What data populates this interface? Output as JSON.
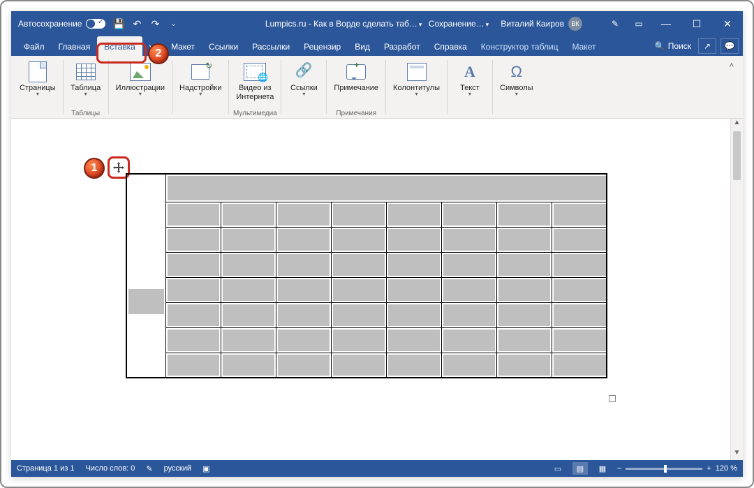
{
  "title": {
    "autosave": "Автосохранение",
    "doc": "Lumpics.ru - Как в Ворде сделать таб…",
    "saving": "Сохранение…",
    "user_name": "Виталий Каиров",
    "user_initials": "ВК"
  },
  "tabs": {
    "file": "Файл",
    "home": "Главная",
    "insert": "Вставка",
    "draw": "ук",
    "layout": "Макет",
    "refs": "Ссылки",
    "mail": "Рассылки",
    "review": "Рецензир",
    "view": "Вид",
    "dev": "Разработ",
    "help": "Справка",
    "ctx_design": "Конструктор таблиц",
    "ctx_layout": "Макет",
    "search": "Поиск"
  },
  "ribbon": {
    "pages": "Страницы",
    "table": "Таблица",
    "tables_grp": "Таблицы",
    "illus": "Иллюстрации",
    "addins": "Надстройки",
    "video_l1": "Видео из",
    "video_l2": "Интернета",
    "media_grp": "Мультимедиа",
    "links": "Ссылки",
    "comment": "Примечание",
    "comments_grp": "Примечания",
    "headers": "Колонтитулы",
    "text": "Текст",
    "symbols": "Символы"
  },
  "table_spec": {
    "rows": 8,
    "cols": 9,
    "col0_merged_rows": 8,
    "header_row_merged_cols": 8,
    "note": "Entire table shown selected (grey fill in body cells and header). Top-left move-handle visible."
  },
  "markers": {
    "m1": "1",
    "m2": "2"
  },
  "status": {
    "page": "Страница 1 из 1",
    "words": "Число слов: 0",
    "lang": "русский",
    "zoom": "120 %"
  }
}
